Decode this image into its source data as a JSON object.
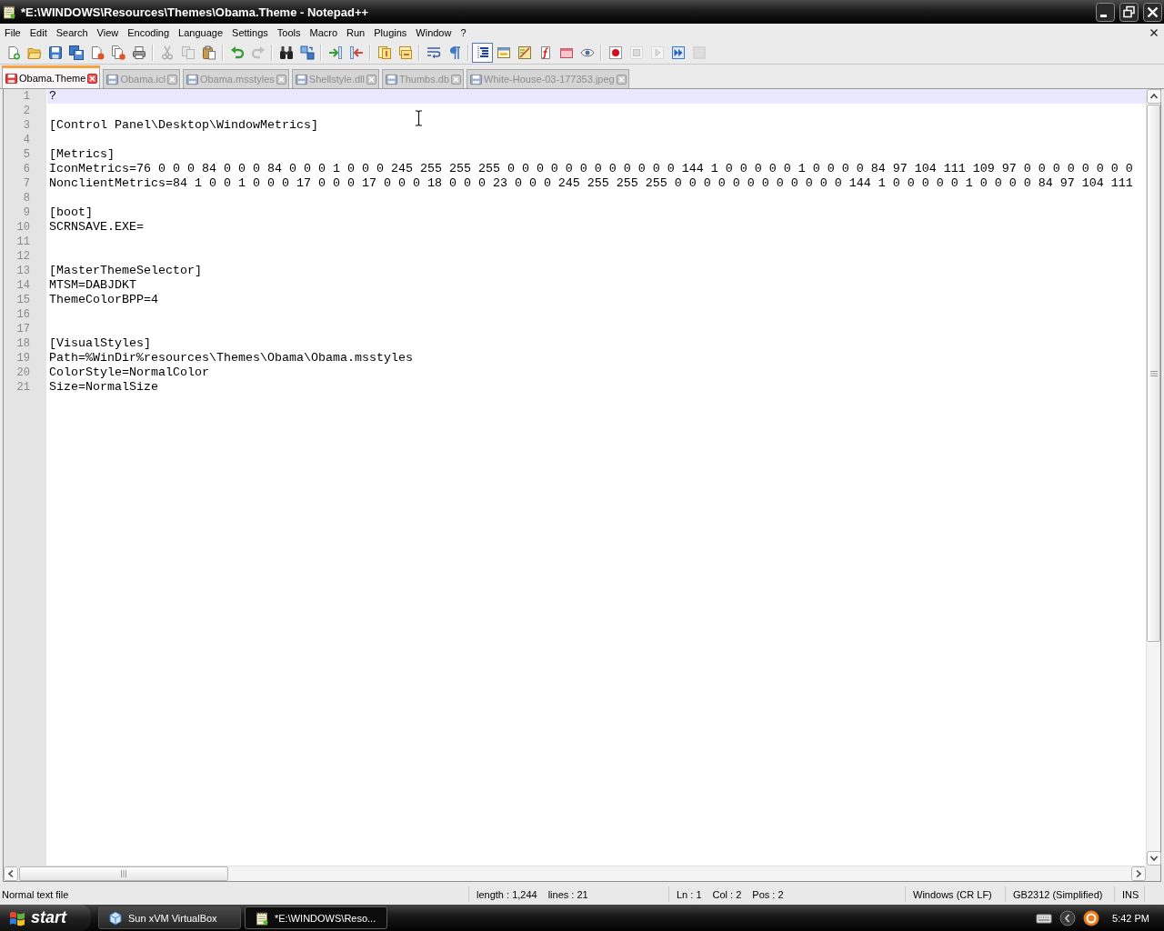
{
  "window": {
    "title": "*E:\\WINDOWS\\Resources\\Themes\\Obama.Theme - Notepad++"
  },
  "menu": [
    "File",
    "Edit",
    "Search",
    "View",
    "Encoding",
    "Language",
    "Settings",
    "Tools",
    "Macro",
    "Run",
    "Plugins",
    "Window",
    "?"
  ],
  "toolbar": [
    [
      {
        "kind": "new",
        "disabled": false,
        "pressed": false
      },
      {
        "kind": "open",
        "disabled": false,
        "pressed": false
      },
      {
        "kind": "save",
        "disabled": false,
        "pressed": false
      },
      {
        "kind": "save_all",
        "disabled": false,
        "pressed": false
      },
      {
        "kind": "close",
        "disabled": false,
        "pressed": false
      },
      {
        "kind": "close_all",
        "disabled": false,
        "pressed": false
      },
      {
        "kind": "print",
        "disabled": false,
        "pressed": false
      }
    ],
    [
      {
        "kind": "cut",
        "disabled": true,
        "pressed": false
      },
      {
        "kind": "copy",
        "disabled": true,
        "pressed": false
      },
      {
        "kind": "paste",
        "disabled": false,
        "pressed": false
      }
    ],
    [
      {
        "kind": "undo",
        "disabled": false,
        "pressed": false
      },
      {
        "kind": "redo",
        "disabled": true,
        "pressed": false
      }
    ],
    [
      {
        "kind": "find",
        "disabled": false,
        "pressed": false
      },
      {
        "kind": "replace",
        "disabled": false,
        "pressed": false
      }
    ],
    [
      {
        "kind": "zoom_in",
        "disabled": false,
        "pressed": false
      },
      {
        "kind": "zoom_out",
        "disabled": false,
        "pressed": false
      }
    ],
    [
      {
        "kind": "sync_vertical",
        "disabled": false,
        "pressed": false
      },
      {
        "kind": "sync_horizontal",
        "disabled": false,
        "pressed": false
      }
    ],
    [
      {
        "kind": "word_wrap",
        "disabled": false,
        "pressed": false
      },
      {
        "kind": "show_all",
        "disabled": false,
        "pressed": false
      }
    ],
    [
      {
        "kind": "indent_guide",
        "disabled": false,
        "pressed": true
      },
      {
        "kind": "user_language",
        "disabled": false,
        "pressed": false
      },
      {
        "kind": "document_map",
        "disabled": false,
        "pressed": false
      },
      {
        "kind": "function_list",
        "disabled": false,
        "pressed": false
      },
      {
        "kind": "folder_workspace",
        "disabled": false,
        "pressed": false
      },
      {
        "kind": "monitoring",
        "disabled": false,
        "pressed": false
      }
    ],
    [
      {
        "kind": "record",
        "disabled": false,
        "pressed": false
      },
      {
        "kind": "stop",
        "disabled": true,
        "pressed": false
      },
      {
        "kind": "play",
        "disabled": true,
        "pressed": false
      },
      {
        "kind": "play_multiple",
        "disabled": false,
        "pressed": false
      },
      {
        "kind": "save_macro",
        "disabled": true,
        "pressed": false
      }
    ]
  ],
  "tabs": [
    {
      "label": "Obama.Theme",
      "selected": true,
      "modified": true
    },
    {
      "label": "Obama.icl",
      "selected": false,
      "modified": false
    },
    {
      "label": "Obama.msstyles",
      "selected": false,
      "modified": false
    },
    {
      "label": "Shellstyle.dll",
      "selected": false,
      "modified": false
    },
    {
      "label": "Thumbs.db",
      "selected": false,
      "modified": false
    },
    {
      "label": "White-House-03-177353.jpeg",
      "selected": false,
      "modified": false
    }
  ],
  "editor": {
    "lines": [
      {
        "number": "1",
        "text": "?",
        "current": true
      },
      {
        "number": "2",
        "current": false
      },
      {
        "number": "3",
        "text": "[Control Panel\\Desktop\\WindowMetrics]",
        "current": false
      },
      {
        "number": "4",
        "current": false
      },
      {
        "number": "5",
        "text": "[Metrics]",
        "current": false
      },
      {
        "number": "6",
        "text": "IconMetrics=76 0 0 0 84 0 0 0 84 0 0 0 1 0 0 0 245 255 255 255 0 0 0 0 0 0 0 0 0 0 0 0 144 1 0 0 0 0 0 1 0 0 0 0 84 97 104 111 109 97 0 0 0 0 0 0 0 0",
        "current": false
      },
      {
        "number": "7",
        "text": "NonclientMetrics=84 1 0 0 1 0 0 0 17 0 0 0 17 0 0 0 18 0 0 0 23 0 0 0 245 255 255 255 0 0 0 0 0 0 0 0 0 0 0 0 144 1 0 0 0 0 0 1 0 0 0 0 84 97 104 111",
        "current": false
      },
      {
        "number": "8",
        "current": false
      },
      {
        "number": "9",
        "text": "[boot]",
        "current": false
      },
      {
        "number": "10",
        "text": "SCRNSAVE.EXE=",
        "current": false
      },
      {
        "number": "11",
        "current": false
      },
      {
        "number": "12",
        "current": false
      },
      {
        "number": "13",
        "text": "[MasterThemeSelector]",
        "current": false
      },
      {
        "number": "14",
        "text": "MTSM=DABJDKT",
        "current": false
      },
      {
        "number": "15",
        "text": "ThemeColorBPP=4",
        "current": false
      },
      {
        "number": "16",
        "current": false
      },
      {
        "number": "17",
        "current": false
      },
      {
        "number": "18",
        "text": "[VisualStyles]",
        "current": false
      },
      {
        "number": "19",
        "text": "Path=%WinDir%resources\\Themes\\Obama\\Obama.msstyles",
        "current": false
      },
      {
        "number": "20",
        "text": "ColorStyle=NormalColor",
        "current": false
      },
      {
        "number": "21",
        "text": "Size=NormalSize",
        "current": false
      }
    ]
  },
  "status_bar": [
    {
      "texts": [
        "Normal text file"
      ]
    },
    {
      "texts": [
        "length : 1,244",
        "lines : 21"
      ]
    },
    {
      "texts": [
        "Ln : 1",
        "Col : 2",
        "Pos : 2"
      ]
    },
    {
      "texts": [
        "Windows (CR LF)"
      ]
    },
    {
      "texts": [
        "GB2312 (Simplified)"
      ]
    },
    {
      "texts": [
        "INS"
      ]
    }
  ],
  "taskbar": {
    "start": "start",
    "tasks": [
      {
        "kind": "cube",
        "label": "Sun xVM VirtualBox",
        "selected": false
      },
      {
        "kind": "notepad",
        "label": "*E:\\WINDOWS\\Reso...",
        "selected": true
      }
    ],
    "clock": "5:42 PM"
  }
}
